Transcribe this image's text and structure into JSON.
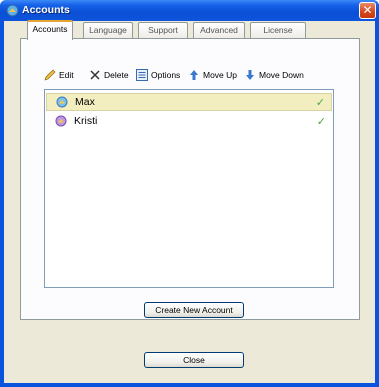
{
  "window": {
    "title": "Accounts",
    "close_glyph": "✕"
  },
  "tabs": [
    {
      "label": "Accounts",
      "active": true
    },
    {
      "label": "Language",
      "active": false
    },
    {
      "label": "Support",
      "active": false
    },
    {
      "label": "Advanced",
      "active": false
    },
    {
      "label": "License",
      "active": false
    }
  ],
  "toolbar": {
    "edit": "Edit",
    "delete": "Delete",
    "options": "Options",
    "move_up": "Move Up",
    "move_down": "Move Down"
  },
  "accounts": [
    {
      "name": "Max",
      "selected": true,
      "enabled": true
    },
    {
      "name": "Kristi",
      "selected": false,
      "enabled": true
    }
  ],
  "buttons": {
    "create_new_account": "Create New Account",
    "close": "Close"
  },
  "colors": {
    "title_bar": "#0a53dc",
    "active_tab_accent": "#e7a436",
    "selection": "#f2eec0",
    "check": "#4fa53a",
    "window_bg": "#ece9d8"
  }
}
